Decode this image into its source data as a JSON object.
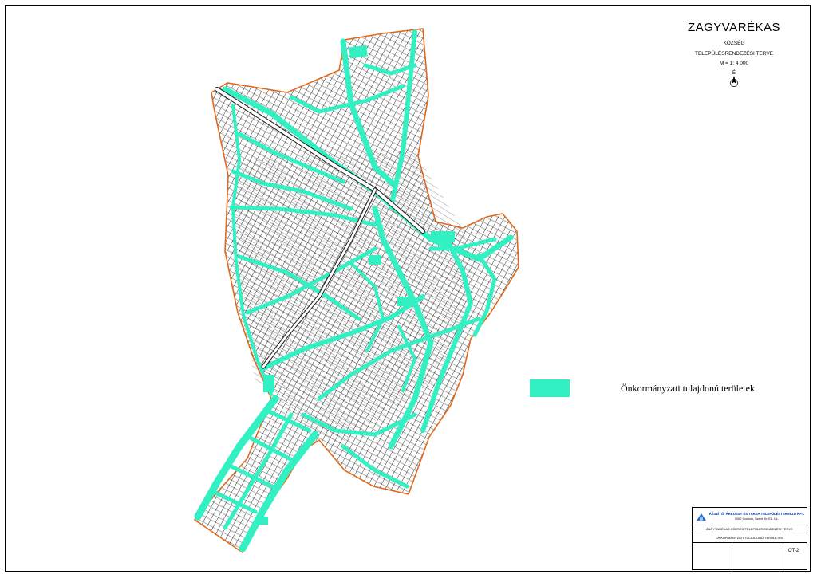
{
  "title": {
    "main": "ZAGYVARÉKAS",
    "sub": "KÖZSÉG",
    "plan": "TELEPÜLÉSRENDEZÉSI TERVE",
    "scale": "M = 1: 4 000"
  },
  "legend": {
    "label": "Önkormányzati tulajdonú területek",
    "color": "#33f0c2"
  },
  "colors": {
    "fill": "#33f0c2",
    "outline": "#e06a1c",
    "lines": "#111111"
  },
  "stamp": {
    "firm": "KÉSZÍTŐ: ÁRKOSSY ÉS TÁRSA TELEPÜLÉSTERVEZŐ KFT.",
    "address": "5000 Szolnok, Szent Kir. EL. ÚL.",
    "project": "ZAGYVARÉKAS KÖZSÉG TELEPÜLÉSRENDEZÉSI TERVE",
    "sheet": "ÖNKORMÁNYZATI TULAJDONÚ TERÜLETEK",
    "code": "OT-2"
  }
}
